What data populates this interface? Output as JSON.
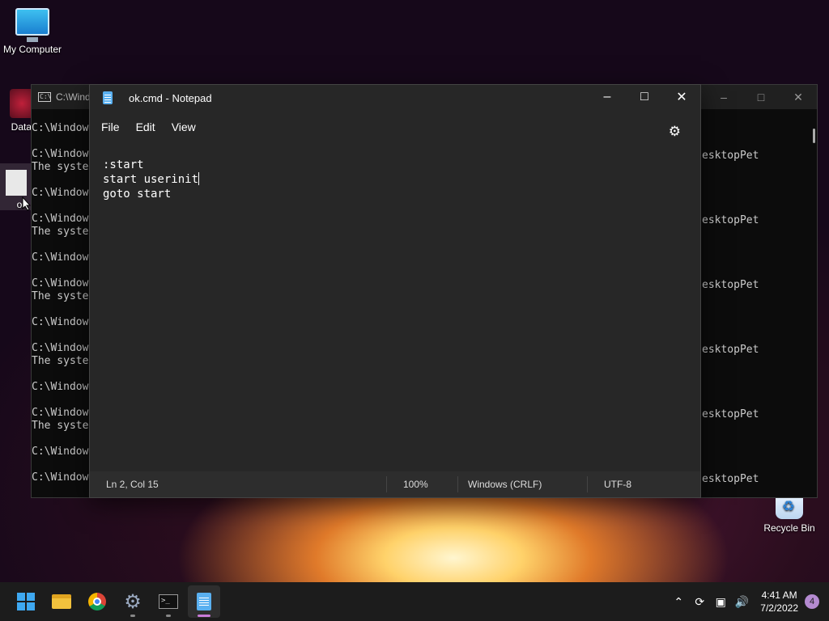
{
  "desktop": {
    "icons": [
      {
        "label": "My Computer",
        "icon": "computer-icon"
      },
      {
        "label": "DataW",
        "icon": "app-shortcut-icon"
      },
      {
        "label": "ok",
        "icon": "cmd-file-icon"
      },
      {
        "label": "Recycle Bin",
        "icon": "recycle-bin-icon"
      }
    ]
  },
  "console": {
    "title": "C:\\Wind",
    "left_lines": [
      "C:\\Window",
      "",
      "C:\\Window",
      "The syste",
      "",
      "C:\\Window",
      "",
      "C:\\Window",
      "The syste",
      "",
      "C:\\Window",
      "",
      "C:\\Window",
      "The syste",
      "",
      "C:\\Window",
      "",
      "C:\\Window",
      "The syste",
      "",
      "C:\\Window",
      "",
      "C:\\Window",
      "The syste",
      "",
      "C:\\Window",
      "",
      "C:\\Window"
    ],
    "right_lines": [
      "esktopPet",
      "esktopPet",
      "esktopPet",
      "esktopPet",
      "esktopPet",
      "esktopPet"
    ]
  },
  "notepad": {
    "title": "ok.cmd - Notepad",
    "menu": {
      "file": "File",
      "edit": "Edit",
      "view": "View"
    },
    "content": {
      "line1": ":start",
      "line2": "start userinit",
      "line3": "goto start"
    },
    "status": {
      "position": "Ln 2, Col 15",
      "zoom": "100%",
      "line_endings": "Windows (CRLF)",
      "encoding": "UTF-8"
    }
  },
  "taskbar": {
    "apps": [
      "start-icon",
      "file-explorer-icon",
      "chrome-icon",
      "settings-icon",
      "terminal-icon",
      "notepad-icon"
    ],
    "time": "4:41 AM",
    "date": "7/2/2022",
    "notifications": "4"
  }
}
